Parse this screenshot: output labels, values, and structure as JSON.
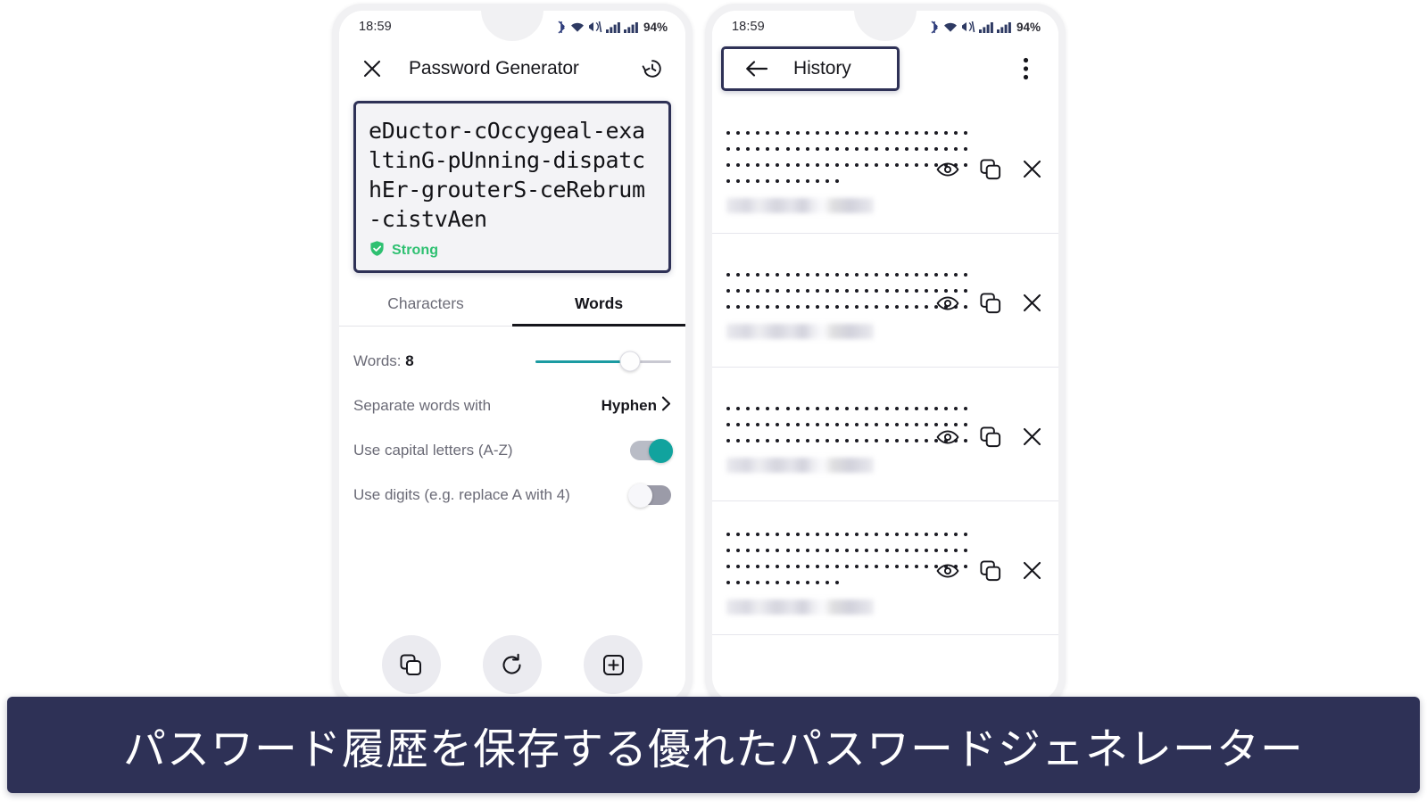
{
  "colors": {
    "highlight_border": "#2e3156",
    "caption_bg": "#2e3156",
    "accent_teal": "#1b9ba2",
    "toggle_on": "#11a39e",
    "strength_green": "#2ec071",
    "phone_frame": "#f1f1f3",
    "tab_indicator": "#16161c"
  },
  "status_bar": {
    "time": "18:59",
    "battery": "94%",
    "icons": [
      "bluetooth-icon",
      "wifi-icon",
      "vibrate-icon",
      "signal-bars-icon",
      "signal-bars-icon"
    ]
  },
  "left_phone": {
    "appbar": {
      "close_icon": "close-icon",
      "title": "Password Generator",
      "history_icon": "history-clock-icon"
    },
    "password": {
      "value": "eDuctor-cOccygeal-exaltinG-pUnning-dispatchEr-grouterS-ceRebrum-cistvAen",
      "strength_label": "Strong",
      "strength_icon": "shield-check-icon"
    },
    "tabs": [
      {
        "label": "Characters",
        "active": false
      },
      {
        "label": "Words",
        "active": true
      }
    ],
    "options": {
      "words_label_prefix": "Words:",
      "words_count": "8",
      "words_slider_percent": 70,
      "separator_label": "Separate words with",
      "separator_value": "Hyphen",
      "separator_chevron": "chevron-right-icon",
      "capitals_label": "Use capital letters (A-Z)",
      "capitals_on": true,
      "digits_label": "Use digits (e.g. replace A with 4)",
      "digits_on": false
    },
    "actions": [
      {
        "name": "copy-password-button",
        "icon": "copy-icon"
      },
      {
        "name": "regenerate-password-button",
        "icon": "refresh-icon"
      },
      {
        "name": "save-password-button",
        "icon": "add-box-icon"
      }
    ]
  },
  "right_phone": {
    "appbar": {
      "back_icon": "arrow-left-icon",
      "title": "History",
      "menu_icon": "more-vertical-icon",
      "highlighted": true
    },
    "history_items": [
      {
        "masked_dot_counts": [
          25,
          25,
          25,
          12
        ],
        "timestamp_redacted": true,
        "actions": [
          "eye-icon",
          "copy-icon",
          "close-icon"
        ]
      },
      {
        "masked_dot_counts": [
          25,
          25,
          25,
          0
        ],
        "timestamp_redacted": true,
        "actions": [
          "eye-icon",
          "copy-icon",
          "close-icon"
        ]
      },
      {
        "masked_dot_counts": [
          25,
          25,
          25,
          0
        ],
        "timestamp_redacted": true,
        "actions": [
          "eye-icon",
          "copy-icon",
          "close-icon"
        ]
      },
      {
        "masked_dot_counts": [
          25,
          25,
          25,
          12
        ],
        "timestamp_redacted": true,
        "actions": [
          "eye-icon",
          "copy-icon",
          "close-icon"
        ]
      }
    ]
  },
  "caption": {
    "text": "パスワード履歴を保存する優れたパスワードジェネレーター"
  }
}
